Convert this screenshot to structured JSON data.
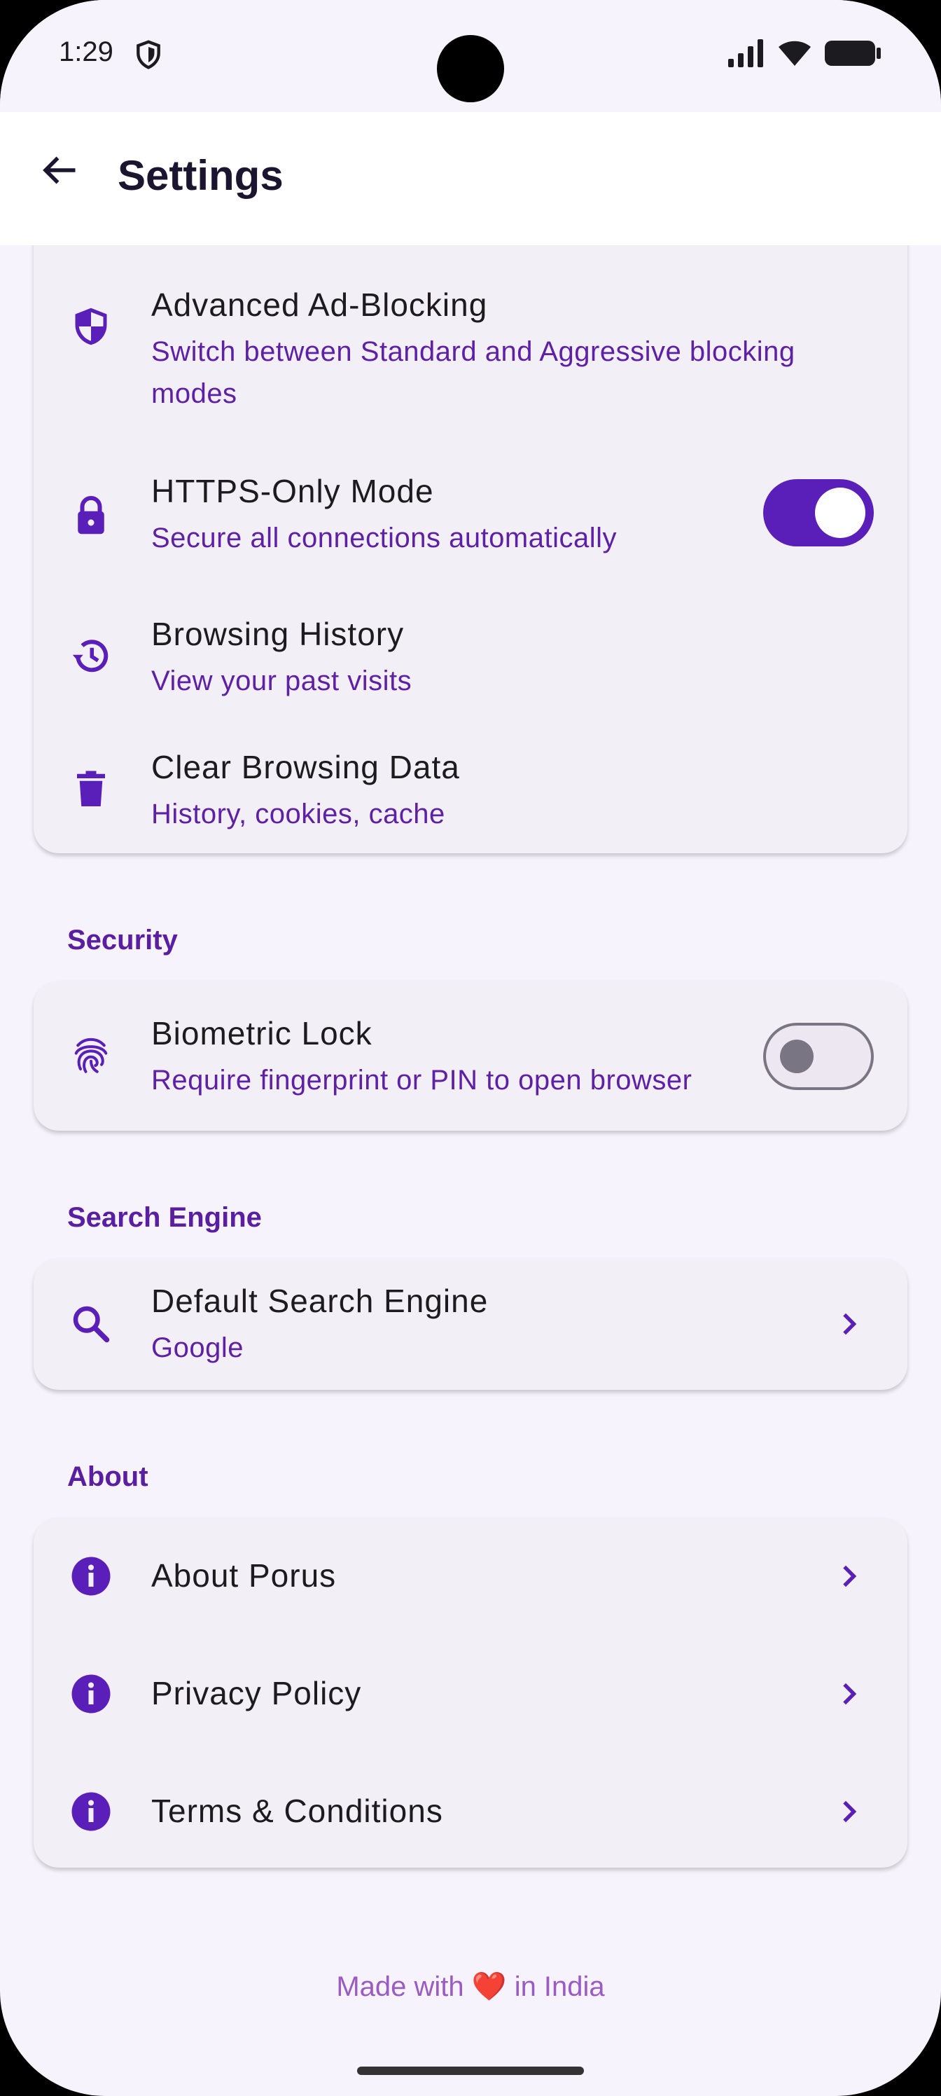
{
  "status_bar": {
    "time": "1:29",
    "icons": [
      "shield-icon",
      "signal-icon",
      "wifi-icon",
      "battery-icon"
    ]
  },
  "app_bar": {
    "title": "Settings",
    "back_icon": "arrow-left-icon"
  },
  "privacy_card": {
    "items": [
      {
        "icon": "shield-half-icon",
        "label": "Advanced Ad-Blocking",
        "subtitle": "Switch between Standard and Aggressive blocking modes"
      },
      {
        "icon": "lock-icon",
        "label": "HTTPS-Only Mode",
        "subtitle": "Secure all connections automatically",
        "toggle": true
      },
      {
        "icon": "history-icon",
        "label": "Browsing History",
        "subtitle": "View your past visits"
      },
      {
        "icon": "trash-icon",
        "label": "Clear Browsing Data",
        "subtitle": "History, cookies, cache"
      }
    ]
  },
  "security": {
    "section_title": "Security",
    "items": [
      {
        "icon": "fingerprint-icon",
        "label": "Biometric Lock",
        "subtitle": "Require fingerprint or PIN to open browser",
        "toggle": false
      }
    ]
  },
  "search_engine": {
    "section_title": "Search Engine",
    "items": [
      {
        "icon": "search-icon",
        "label": "Default Search Engine",
        "subtitle": "Google"
      }
    ]
  },
  "about": {
    "section_title": "About",
    "items": [
      {
        "icon": "info-icon",
        "label": "About Porus"
      },
      {
        "icon": "info-icon",
        "label": "Privacy Policy"
      },
      {
        "icon": "info-icon",
        "label": "Terms & Conditions"
      }
    ]
  },
  "footer": {
    "text_before": "Made with",
    "heart": "❤️",
    "text_after": "in India"
  },
  "colors": {
    "accent": "#5a1fb8",
    "subtitle": "#5e21a6",
    "background": "#f7f3fc",
    "card": "#f3eff6"
  }
}
